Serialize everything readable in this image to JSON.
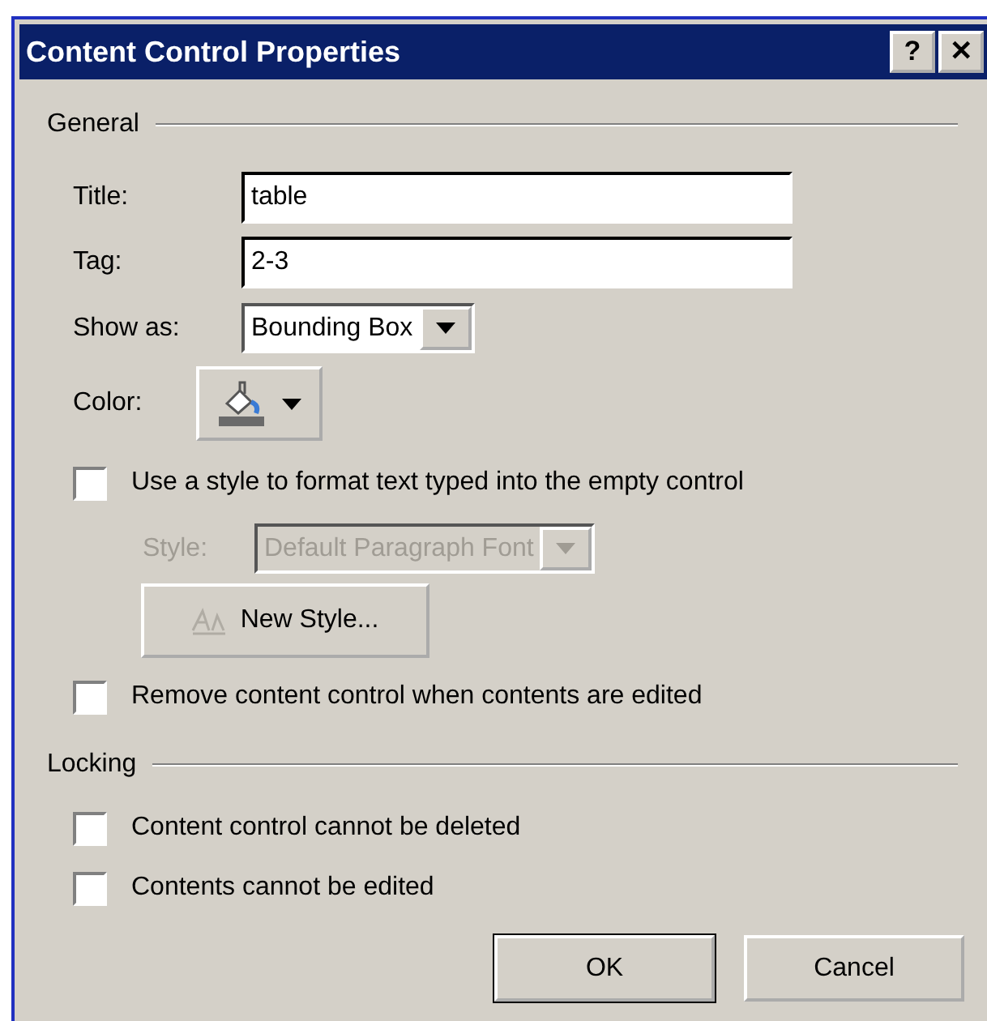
{
  "window": {
    "title": "Content Control Properties",
    "buttons": [
      {
        "label": "?"
      },
      {
        "label": "✕"
      }
    ]
  },
  "general": {
    "heading": "General",
    "fields": [
      {
        "kind": "text",
        "label": "Title:",
        "value": "table"
      },
      {
        "kind": "text",
        "label": "Tag:",
        "value": "2-3"
      },
      {
        "kind": "combo",
        "label": "Show as:",
        "value": "Bounding Box"
      },
      {
        "kind": "color",
        "label": "Color:"
      }
    ],
    "use_style": {
      "label": "Use a style to format text typed into the empty control",
      "checked": false
    },
    "style": {
      "label": "Style:",
      "value": "Default Paragraph Font",
      "disabled": true
    },
    "new_style": {
      "label": "New Style...",
      "disabled": true
    },
    "remove": {
      "label": "Remove content control when contents are edited",
      "checked": false
    }
  },
  "locking": {
    "heading": "Locking",
    "options": [
      {
        "label": "Content control cannot be deleted",
        "checked": false
      },
      {
        "label": "Contents cannot be edited",
        "checked": false
      }
    ]
  },
  "buttons": [
    {
      "label": "OK",
      "default": true
    },
    {
      "label": "Cancel",
      "default": false
    }
  ]
}
